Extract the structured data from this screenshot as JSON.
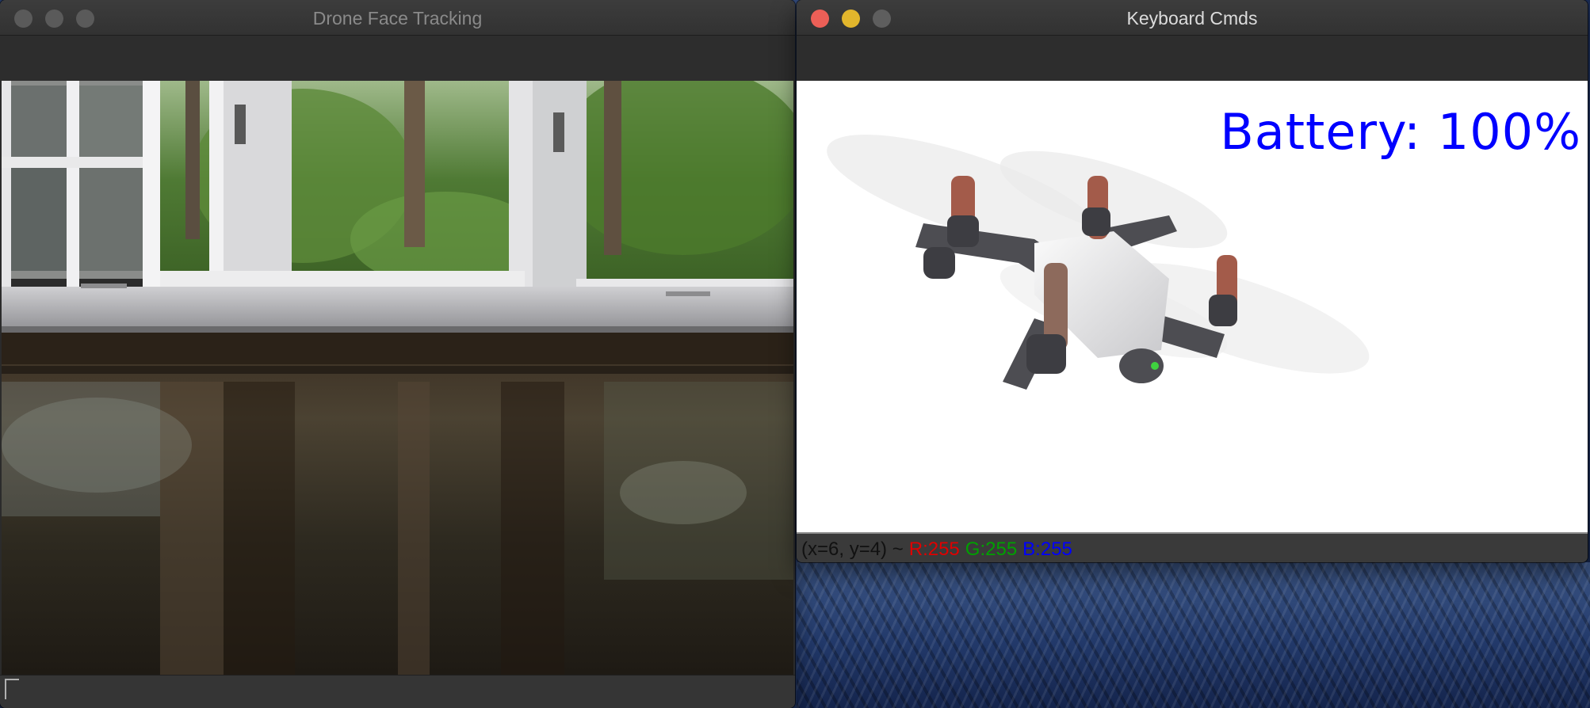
{
  "windows": {
    "left": {
      "title": "Drone Face Tracking"
    },
    "right": {
      "title": "Keyboard Cmds",
      "overlay": {
        "battery_text": "Battery: 100%"
      },
      "status": {
        "coords": "(x=6, y=4) ~",
        "r": "R:255",
        "g": "G:255",
        "b": "B:255"
      }
    }
  },
  "colors": {
    "close": "#ec5f57",
    "minimize": "#e2b62c",
    "inactive": "#5a5a5a",
    "battery_text": "#0000ff",
    "status_r": "#e00000",
    "status_g": "#00a000",
    "status_b": "#0000ff"
  },
  "icons": [
    "close-button",
    "minimize-button",
    "zoom-button",
    "resize-grip-icon"
  ]
}
